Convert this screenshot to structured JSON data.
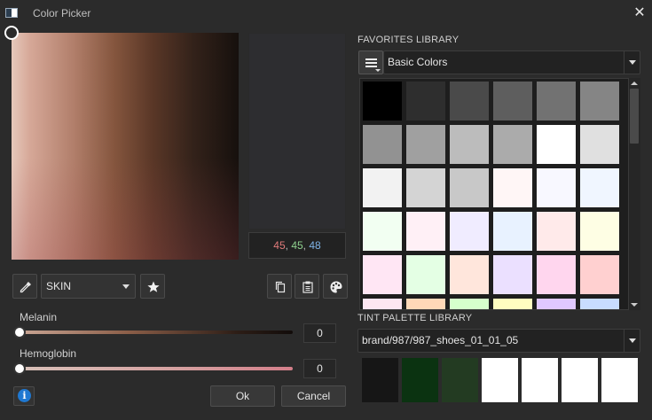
{
  "window": {
    "title": "Color Picker",
    "close_glyph": "✕"
  },
  "current_color": {
    "r": "45",
    "g": "45",
    "b": "48",
    "sep": ","
  },
  "controls": {
    "mode_select": "SKIN",
    "icons": [
      "eyedropper-icon",
      "star-icon",
      "copy-icon",
      "paste-icon",
      "palette-icon",
      "menu-icon",
      "info-icon"
    ]
  },
  "sliders": {
    "melanin": {
      "label": "Melanin",
      "value": "0"
    },
    "hemoglobin": {
      "label": "Hemoglobin",
      "value": "0"
    }
  },
  "buttons": {
    "ok": "Ok",
    "cancel": "Cancel",
    "info": "i"
  },
  "favorites": {
    "section_label": "FAVORITES LIBRARY",
    "library_name": "Basic Colors",
    "swatches": [
      "#000000",
      "#2e2e2e",
      "#4a4a4a",
      "#5e5e5e",
      "#727272",
      "#858585",
      "#929292",
      "#a0a0a0",
      "#bcbcbc",
      "#ababab",
      "#ffffff",
      "#e0e0e0",
      "#f2f2f2",
      "#d4d4d4",
      "#c8c8c8",
      "#fff6f6",
      "#f8f8ff",
      "#f0f6ff",
      "#f2fff2",
      "#fff0f6",
      "#f0ecff",
      "#e8f2ff",
      "#ffeaea",
      "#fefee4",
      "#ffe6f4",
      "#e4ffe4",
      "#ffe6dc",
      "#ebe0ff",
      "#ffd6ee",
      "#ffd0d0",
      "#fde6f1",
      "#ffd8b8",
      "#d6ffcc",
      "#fffdc0",
      "#e0c8ff",
      "#c8dcff"
    ]
  },
  "tint": {
    "section_label": "TINT PALETTE LIBRARY",
    "palette_name": "brand/987/987_shoes_01_01_05",
    "swatches": [
      "#161616",
      "#0b3311",
      "#233b22",
      "#ffffff",
      "#ffffff",
      "#ffffff",
      "#ffffff"
    ]
  }
}
